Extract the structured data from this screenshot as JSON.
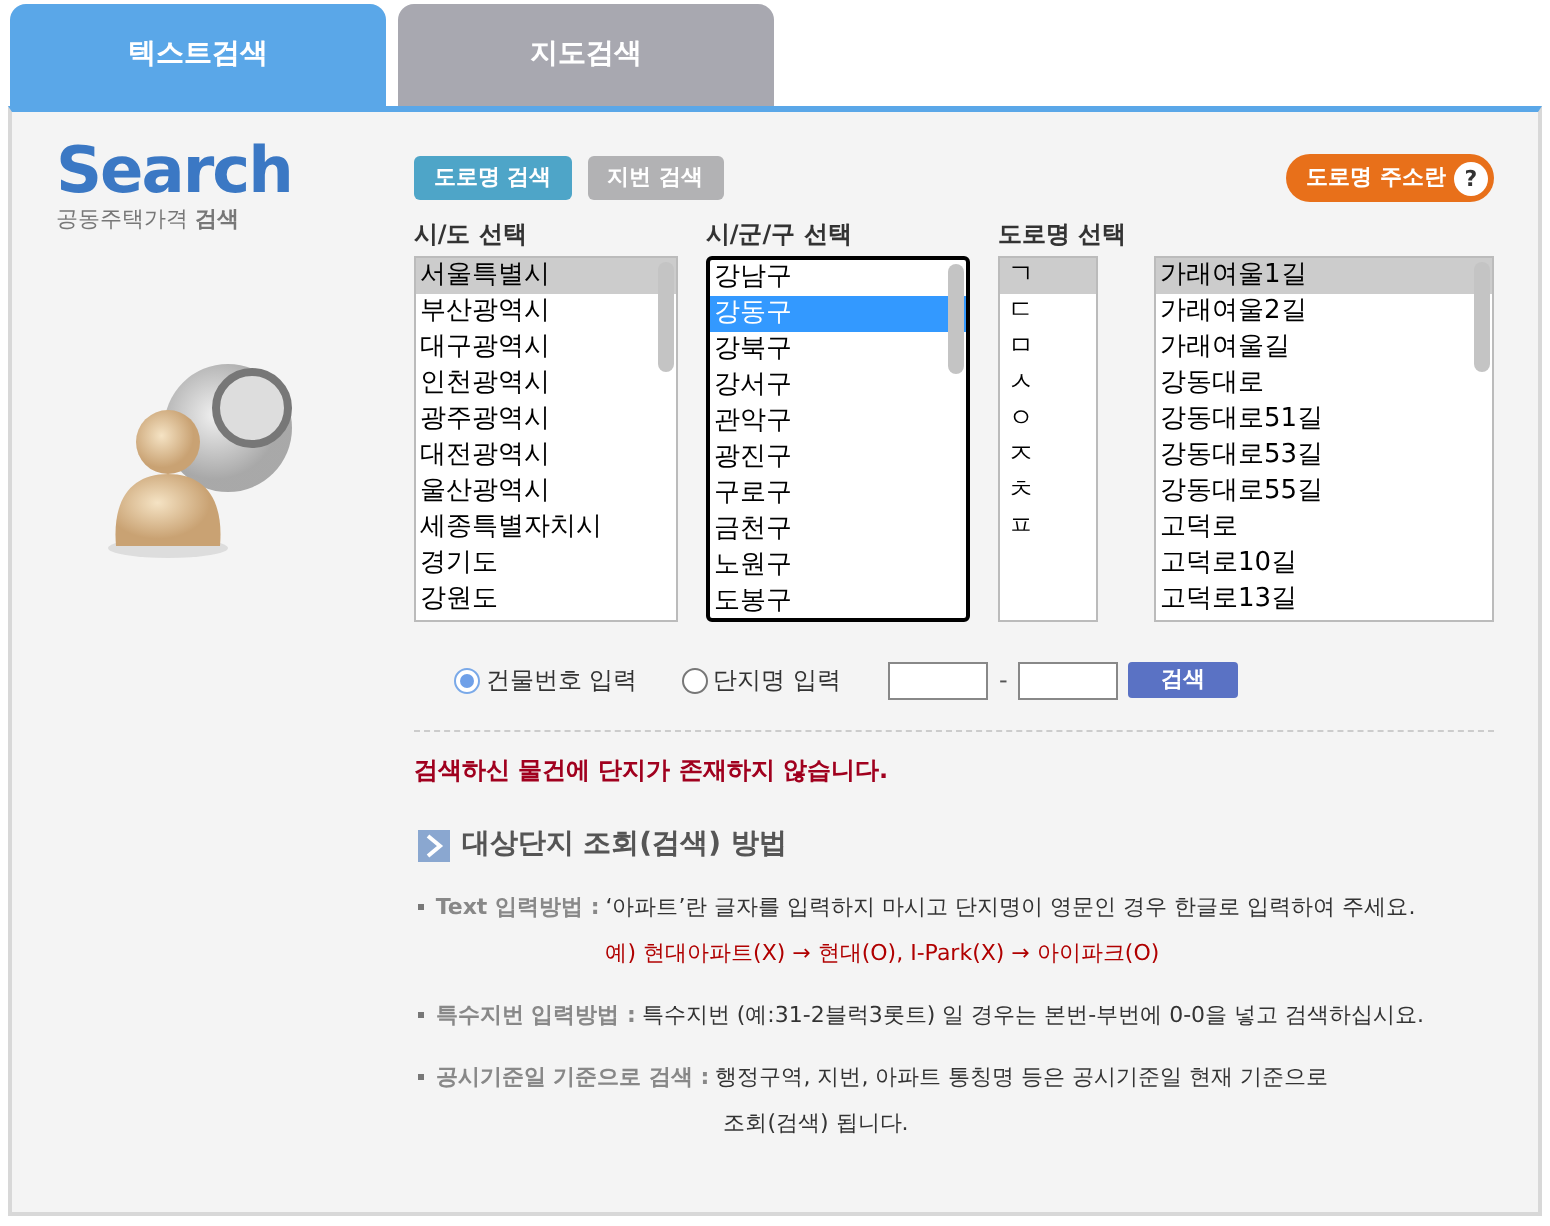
{
  "tabs": [
    {
      "label": "텍스트검색",
      "selected": true
    },
    {
      "label": "지도검색",
      "selected": false
    }
  ],
  "logo": {
    "title": "Search",
    "subtitle_light": "공동주택가격",
    "subtitle_bold": "검색"
  },
  "mode_buttons": [
    {
      "label": "도로명 검색",
      "selected": true
    },
    {
      "label": "지번 검색",
      "selected": false
    }
  ],
  "help_button": {
    "label": "도로명 주소란",
    "icon_text": "?"
  },
  "lists": [
    {
      "title": "시/도 선택",
      "focused": false,
      "kind": "wide",
      "items": [
        {
          "label": "서울특별시",
          "selected": true
        },
        {
          "label": "부산광역시",
          "selected": false
        },
        {
          "label": "대구광역시",
          "selected": false
        },
        {
          "label": "인천광역시",
          "selected": false
        },
        {
          "label": "광주광역시",
          "selected": false
        },
        {
          "label": "대전광역시",
          "selected": false
        },
        {
          "label": "울산광역시",
          "selected": false
        },
        {
          "label": "세종특별자치시",
          "selected": false
        },
        {
          "label": "경기도",
          "selected": false
        },
        {
          "label": "강원도",
          "selected": false
        }
      ]
    },
    {
      "title": "시/군/구 선택",
      "focused": true,
      "kind": "wide",
      "items": [
        {
          "label": "강남구",
          "selected": false
        },
        {
          "label": "강동구",
          "selected": true
        },
        {
          "label": "강북구",
          "selected": false
        },
        {
          "label": "강서구",
          "selected": false
        },
        {
          "label": "관악구",
          "selected": false
        },
        {
          "label": "광진구",
          "selected": false
        },
        {
          "label": "구로구",
          "selected": false
        },
        {
          "label": "금천구",
          "selected": false
        },
        {
          "label": "노원구",
          "selected": false
        },
        {
          "label": "도봉구",
          "selected": false
        }
      ]
    },
    {
      "title": "도로명 선택",
      "focused": false,
      "kind": "narrow",
      "items": [
        {
          "label": "ㄱ",
          "selected": true
        },
        {
          "label": "ㄷ",
          "selected": false
        },
        {
          "label": "ㅁ",
          "selected": false
        },
        {
          "label": "ㅅ",
          "selected": false
        },
        {
          "label": "ㅇ",
          "selected": false
        },
        {
          "label": "ㅈ",
          "selected": false
        },
        {
          "label": "ㅊ",
          "selected": false
        },
        {
          "label": "ㅍ",
          "selected": false
        }
      ]
    },
    {
      "focused": false,
      "kind": "road",
      "items": [
        {
          "label": "가래여울1길",
          "selected": true
        },
        {
          "label": "가래여울2길",
          "selected": false
        },
        {
          "label": "가래여울길",
          "selected": false
        },
        {
          "label": "강동대로",
          "selected": false
        },
        {
          "label": "강동대로51길",
          "selected": false
        },
        {
          "label": "강동대로53길",
          "selected": false
        },
        {
          "label": "강동대로55길",
          "selected": false
        },
        {
          "label": "고덕로",
          "selected": false
        },
        {
          "label": "고덕로10길",
          "selected": false
        },
        {
          "label": "고덕로13길",
          "selected": false
        }
      ]
    }
  ],
  "input_modes": [
    {
      "label": "건물번호 입력",
      "selected": true
    },
    {
      "label": "단지명 입력",
      "selected": false
    }
  ],
  "number_separator": "-",
  "search_button": "검색",
  "message": "검색하신 물건에 단지가 존재하지 않습니다.",
  "section_title": "대상단지 조회(검색) 방법",
  "instructions": [
    {
      "label": "Text 입력방법 :",
      "lines": [
        "‘아파트’란 글자를 입력하지 마시고 단지명이 영문인 경우 한글로 입력하여 주세요."
      ],
      "example": "예) 현대아파트(X) → 현대(O), I-Park(X) → 아이파크(O)"
    },
    {
      "label": "특수지번 입력방법 :",
      "lines": [
        "특수지번 (예:31-2블럭3롯트) 일 경우는 본번-부번에 0-0을 넣고 검색하십시요."
      ]
    },
    {
      "label": "공시기준일 기준으로 검색 :",
      "lines": [
        "행정구역, 지번, 아파트 통칭명 등은 공시기준일 현재 기준으로",
        "조회(검색) 됩니다."
      ]
    }
  ]
}
